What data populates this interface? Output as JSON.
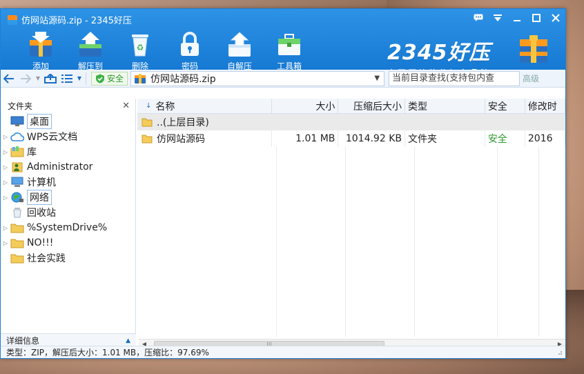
{
  "window": {
    "title": "仿网站源码.zip - 2345好压",
    "controls": [
      "chat-icon",
      "menu-icon",
      "minimize-icon",
      "maximize-icon",
      "close-icon"
    ]
  },
  "toolbar": {
    "items": [
      {
        "label": "添加",
        "icon": "add-archive-icon"
      },
      {
        "label": "解压到",
        "icon": "extract-icon"
      },
      {
        "label": "删除",
        "icon": "recycle-bin-icon"
      },
      {
        "label": "密码",
        "icon": "lock-icon"
      },
      {
        "label": "自解压",
        "icon": "self-extract-icon"
      },
      {
        "label": "工具箱",
        "icon": "toolbox-icon"
      }
    ]
  },
  "brand": {
    "logo": "2345好压",
    "tagline": "中国压缩软件知名品牌"
  },
  "navbar": {
    "safe_label": "安全",
    "address": "仿网站源码.zip",
    "search_placeholder": "当前目录查找(支持包内查",
    "advanced": "高级"
  },
  "left_panel": {
    "title": "文件夹",
    "items": [
      {
        "label": "桌面",
        "icon": "desktop-icon",
        "has_children": false,
        "selected": true
      },
      {
        "label": "WPS云文档",
        "icon": "cloud-icon",
        "has_children": true
      },
      {
        "label": "库",
        "icon": "library-icon",
        "has_children": true
      },
      {
        "label": "Administrator",
        "icon": "user-icon",
        "has_children": true
      },
      {
        "label": "计算机",
        "icon": "computer-icon",
        "has_children": true
      },
      {
        "label": "网络",
        "icon": "network-icon",
        "has_children": true,
        "highlighted": true
      },
      {
        "label": "回收站",
        "icon": "recycle-bin-icon",
        "has_children": false
      },
      {
        "label": "%SystemDrive%",
        "icon": "folder-icon",
        "has_children": true
      },
      {
        "label": "NO!!!",
        "icon": "folder-icon",
        "has_children": true
      },
      {
        "label": "社会实践",
        "icon": "folder-icon",
        "has_children": false
      }
    ],
    "footer": "详细信息"
  },
  "file_list": {
    "columns": [
      "名称",
      "大小",
      "压缩后大小",
      "类型",
      "安全",
      "修改时"
    ],
    "rows": [
      {
        "name": "..(上层目录)",
        "size": "",
        "compressed": "",
        "type": "",
        "safe": "",
        "modified": "",
        "parent": true
      },
      {
        "name": "仿网站源码",
        "size": "1.01 MB",
        "compressed": "1014.92 KB",
        "type": "文件夹",
        "safe": "安全",
        "modified": "2016",
        "parent": false
      }
    ]
  },
  "status": {
    "text": "类型：ZIP，解压后大小：1.01 MB，压缩比：97.69%"
  },
  "colors": {
    "titlebar": "#1a7fd8",
    "safe_green": "#2d9a2d",
    "accent": "#1a6fc4"
  }
}
